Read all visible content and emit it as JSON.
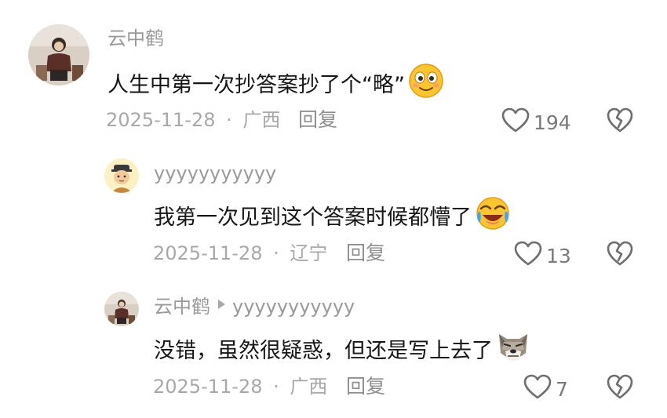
{
  "comments": [
    {
      "username": "云中鹤",
      "text": "人生中第一次抄答案抄了个“略”",
      "emoji": "smiling-face-emoji",
      "date": "2025-11-28",
      "region": "广西",
      "reply_label": "回复",
      "likes": "194"
    },
    {
      "username": "yyyyyyyyyyy",
      "text": "我第一次见到这个答案时候都懵了",
      "emoji": "rolling-laughing-emoji",
      "date": "2025-11-28",
      "region": "辽宁",
      "reply_label": "回复",
      "likes": "13"
    },
    {
      "username": "云中鹤",
      "reply_target": "yyyyyyyyyyy",
      "text": "没错，虽然很疑惑，但还是写上去了",
      "emoji": "dog-face-emoji",
      "date": "2025-11-28",
      "region": "广西",
      "reply_label": "回复",
      "likes": "7"
    }
  ],
  "meta_separator": "·",
  "colors": {
    "text": "#161616",
    "muted": "#9a9a9a",
    "icon": "#7a7a7a"
  }
}
